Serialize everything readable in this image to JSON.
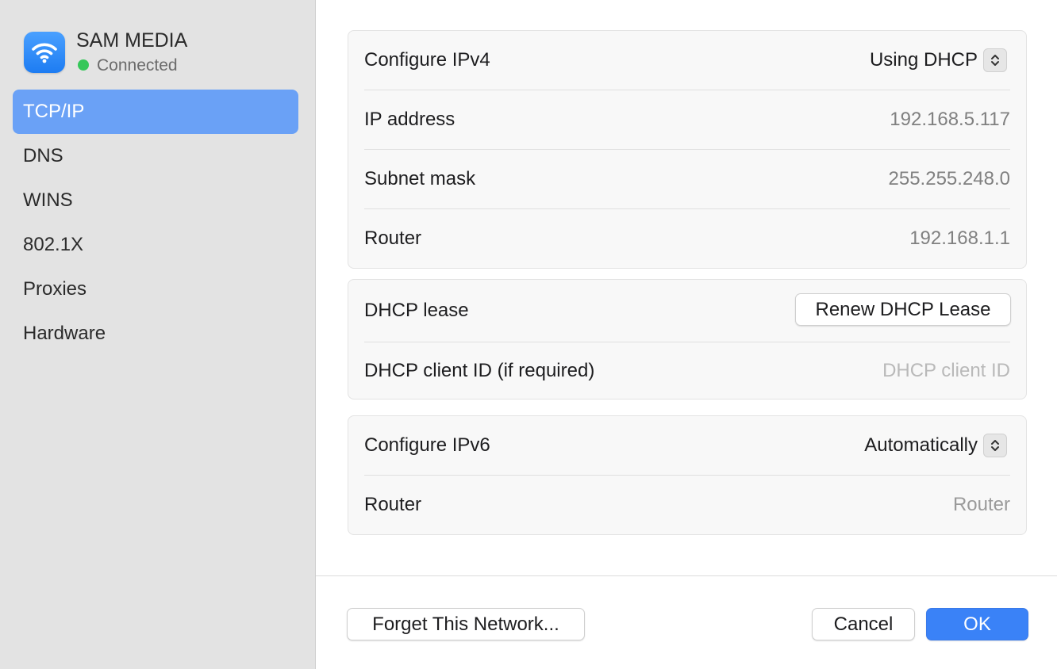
{
  "network": {
    "name": "SAM MEDIA",
    "status": "Connected",
    "status_color": "#35c759",
    "icon": "wifi-icon"
  },
  "sidebar": {
    "items": [
      {
        "label": "TCP/IP",
        "selected": true
      },
      {
        "label": "DNS",
        "selected": false
      },
      {
        "label": "WINS",
        "selected": false
      },
      {
        "label": "802.1X",
        "selected": false
      },
      {
        "label": "Proxies",
        "selected": false
      },
      {
        "label": "Hardware",
        "selected": false
      }
    ]
  },
  "ipv4": {
    "configure_label": "Configure IPv4",
    "configure_value": "Using DHCP",
    "ip_label": "IP address",
    "ip_value": "192.168.5.117",
    "subnet_label": "Subnet mask",
    "subnet_value": "255.255.248.0",
    "router_label": "Router",
    "router_value": "192.168.1.1"
  },
  "dhcp": {
    "lease_label": "DHCP lease",
    "renew_button": "Renew DHCP Lease",
    "client_id_label": "DHCP client ID (if required)",
    "client_id_placeholder": "DHCP client ID"
  },
  "ipv6": {
    "configure_label": "Configure IPv6",
    "configure_value": "Automatically",
    "router_label": "Router",
    "router_placeholder": "Router"
  },
  "footer": {
    "forget_button": "Forget This Network...",
    "cancel_button": "Cancel",
    "ok_button": "OK"
  },
  "colors": {
    "accent": "#3a82f7",
    "sidebar_selected": "#6aa1f6"
  }
}
